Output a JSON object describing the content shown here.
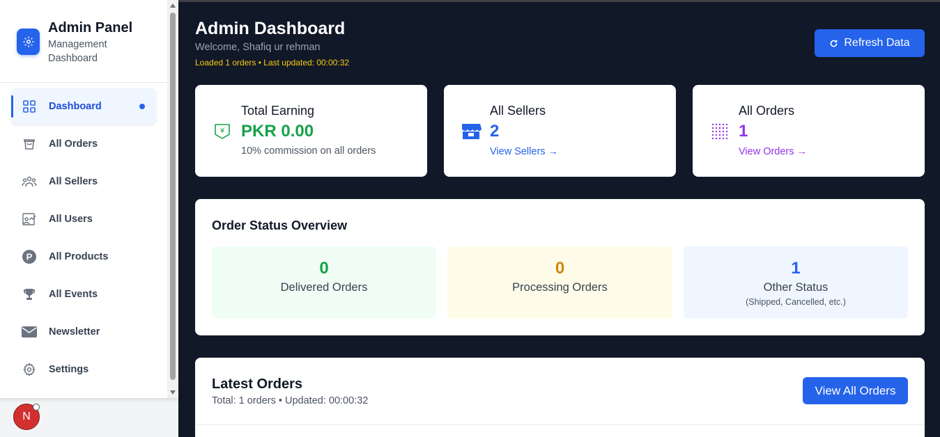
{
  "sidebar": {
    "brand_title": "Admin Panel",
    "brand_subtitle": "Management Dashboard",
    "items": [
      {
        "label": "Dashboard",
        "icon": "grid-icon",
        "active": true
      },
      {
        "label": "All Orders",
        "icon": "shopping-bag-icon"
      },
      {
        "label": "All Sellers",
        "icon": "users-group-icon"
      },
      {
        "label": "All Users",
        "icon": "user-chart-icon"
      },
      {
        "label": "All Products",
        "icon": "product-p-icon"
      },
      {
        "label": "All Events",
        "icon": "trophy-icon"
      },
      {
        "label": "Newsletter",
        "icon": "mail-icon"
      },
      {
        "label": "Settings",
        "icon": "gear-icon"
      }
    ],
    "avatar_initial": "N"
  },
  "header": {
    "title": "Admin Dashboard",
    "welcome": "Welcome, Shafiq ur rehman",
    "loaded_status": "Loaded 1 orders • Last updated: 00:00:32",
    "refresh_label": "Refresh Data"
  },
  "stats": {
    "earning": {
      "title": "Total Earning",
      "value": "PKR 0.00",
      "sub": "10% commission on all orders",
      "color": "#16a34a"
    },
    "sellers": {
      "title": "All Sellers",
      "value": "2",
      "link": "View Sellers →",
      "color": "#2563eb"
    },
    "orders": {
      "title": "All Orders",
      "value": "1",
      "link": "View Orders →",
      "color": "#9333ea"
    }
  },
  "overview": {
    "title": "Order Status Overview",
    "delivered": {
      "count": "0",
      "label": "Delivered Orders"
    },
    "processing": {
      "count": "0",
      "label": "Processing Orders"
    },
    "other": {
      "count": "1",
      "label": "Other Status",
      "note": "(Shipped, Cancelled, etc.)"
    }
  },
  "latest": {
    "title": "Latest Orders",
    "subtitle": "Total: 1 orders • Updated: 00:00:32",
    "view_all_label": "View All Orders"
  }
}
